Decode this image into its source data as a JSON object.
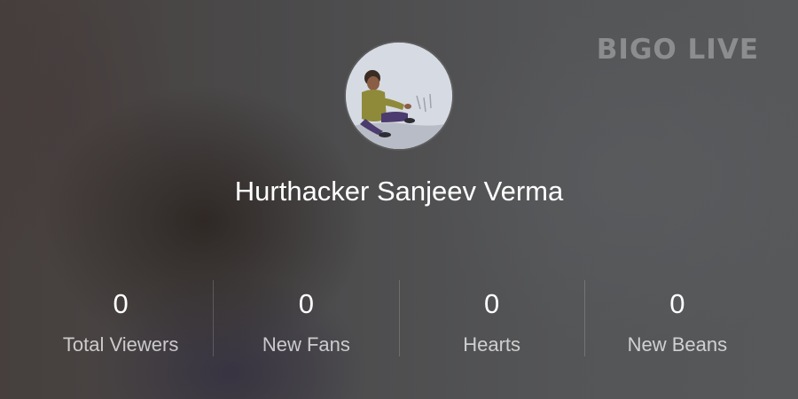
{
  "brand": {
    "logo_text": "BIGO LIVE"
  },
  "profile": {
    "name": "Hurthacker Sanjeev Verma"
  },
  "stats": [
    {
      "value": "0",
      "label": "Total Viewers"
    },
    {
      "value": "0",
      "label": "New Fans"
    },
    {
      "value": "0",
      "label": "Hearts"
    },
    {
      "value": "0",
      "label": "New Beans"
    }
  ],
  "colors": {
    "text_primary": "#ffffff",
    "background": "#4a4b4d"
  }
}
